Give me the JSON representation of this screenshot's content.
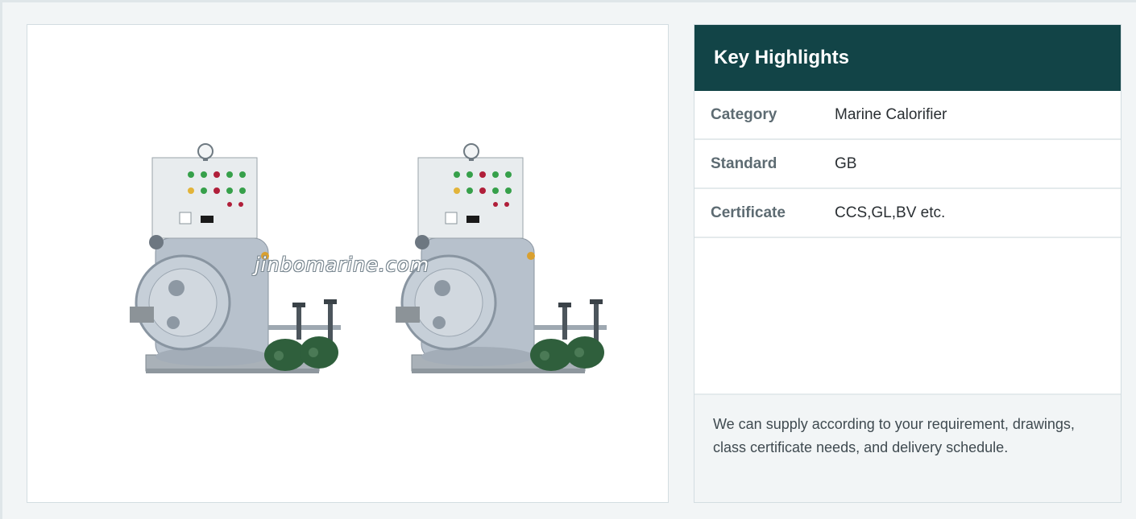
{
  "product_image": {
    "watermark": "jinbomarine.com",
    "alt_subject": "marine-calorifier-photo"
  },
  "highlights": {
    "title": "Key Highlights",
    "rows": [
      {
        "label": "Category",
        "value": "Marine Calorifier"
      },
      {
        "label": "Standard",
        "value": "GB"
      },
      {
        "label": "Certificate",
        "value": "CCS,GL,BV etc."
      }
    ],
    "footer_note": "We can supply according to your requirement, drawings, class certificate needs, and delivery schedule."
  },
  "colors": {
    "header_bg": "#124447",
    "page_bg": "#f2f5f6",
    "border": "#d3dde1"
  }
}
